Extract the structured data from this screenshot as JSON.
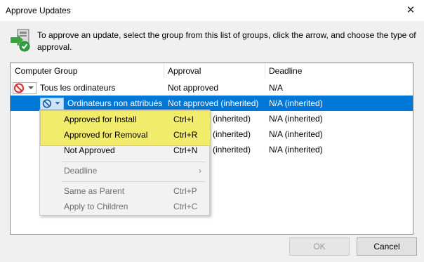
{
  "window": {
    "title": "Approve Updates",
    "close_glyph": "✕"
  },
  "instruction": "To approve an update, select the group from this list of groups, click the arrow, and choose the type of approval.",
  "columns": [
    {
      "label": "Computer Group"
    },
    {
      "label": "Approval"
    },
    {
      "label": "Deadline"
    }
  ],
  "rows": [
    {
      "group": "Tous les ordinateurs",
      "approval": "Not approved",
      "deadline": "N/A",
      "icon": "not-approved-icon"
    },
    {
      "group": "Ordinateurs non attribués",
      "approval": "Not approved (inherited)",
      "deadline": "N/A (inherited)",
      "icon": "blocked-icon"
    },
    {
      "approval": "(inherited)",
      "deadline": "N/A (inherited)"
    },
    {
      "approval": "(inherited)",
      "deadline": "N/A (inherited)"
    },
    {
      "approval": "(inherited)",
      "deadline": "N/A (inherited)"
    }
  ],
  "context_menu": {
    "items": [
      {
        "label": "Approved for Install",
        "shortcut": "Ctrl+I",
        "enabled": true,
        "highlighted": true
      },
      {
        "label": "Approved for Removal",
        "shortcut": "Ctrl+R",
        "enabled": true,
        "highlighted": true
      },
      {
        "label": "Not Approved",
        "shortcut": "Ctrl+N",
        "enabled": true
      },
      {
        "label": "Deadline",
        "shortcut": "›",
        "enabled": false
      },
      {
        "label": "Same as Parent",
        "shortcut": "Ctrl+P",
        "enabled": false
      },
      {
        "label": "Apply to Children",
        "shortcut": "Ctrl+C",
        "enabled": false
      }
    ],
    "highlight_color": "#f1ec6b"
  },
  "buttons": {
    "ok": "OK",
    "cancel": "Cancel"
  },
  "colors": {
    "selection": "#0078d7",
    "highlight": "#f1ec6b"
  }
}
